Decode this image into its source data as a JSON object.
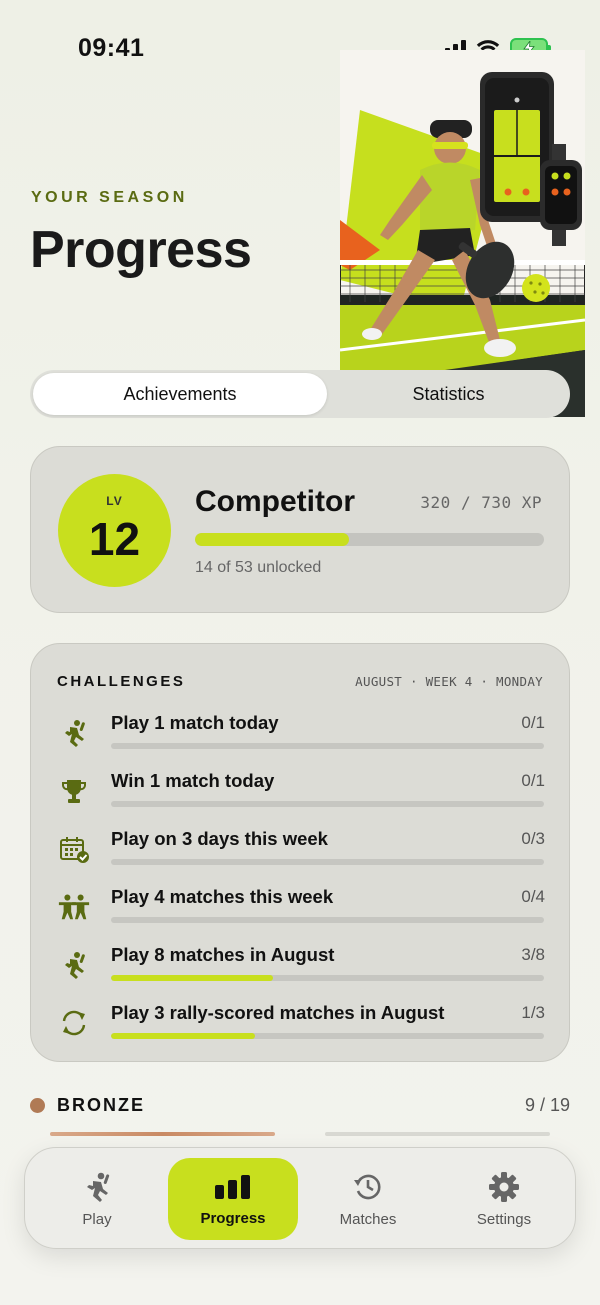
{
  "status": {
    "time": "09:41"
  },
  "header": {
    "eyebrow": "YOUR SEASON",
    "title": "Progress"
  },
  "segments": {
    "active": "Achievements",
    "inactive": "Statistics"
  },
  "level": {
    "lv_label": "LV",
    "number": "12",
    "rank": "Competitor",
    "xp_text": "320 / 730 XP",
    "xp_progress": 0.44,
    "unlocked_text": "14 of 53 unlocked"
  },
  "challenges": {
    "title": "CHALLENGES",
    "meta": "AUGUST · WEEK 4 · MONDAY",
    "items": [
      {
        "icon": "player-running-icon",
        "label": "Play 1 match today",
        "count": "0/1",
        "progress": 0
      },
      {
        "icon": "trophy-icon",
        "label": "Win 1 match today",
        "count": "0/1",
        "progress": 0
      },
      {
        "icon": "calendar-check-icon",
        "label": "Play on 3 days this week",
        "count": "0/3",
        "progress": 0
      },
      {
        "icon": "two-players-icon",
        "label": "Play 4 matches this week",
        "count": "0/4",
        "progress": 0
      },
      {
        "icon": "player-running-icon",
        "label": "Play 8 matches in August",
        "count": "3/8",
        "progress": 0.375
      },
      {
        "icon": "refresh-cycle-icon",
        "label": "Play 3 rally-scored matches in August",
        "count": "1/3",
        "progress": 0.333
      }
    ]
  },
  "tier": {
    "name": "BRONZE",
    "count": "9 / 19",
    "color": "#b07a55"
  },
  "tabs": [
    {
      "label": "Play",
      "icon": "player-icon"
    },
    {
      "label": "Progress",
      "icon": "bar-chart-icon"
    },
    {
      "label": "Matches",
      "icon": "history-clock-icon"
    },
    {
      "label": "Settings",
      "icon": "gear-icon"
    }
  ],
  "colors": {
    "accent": "#c8df1e",
    "eyebrow": "#5a6b12",
    "bronze": "#b07a55",
    "card": "#dcdcd6"
  }
}
